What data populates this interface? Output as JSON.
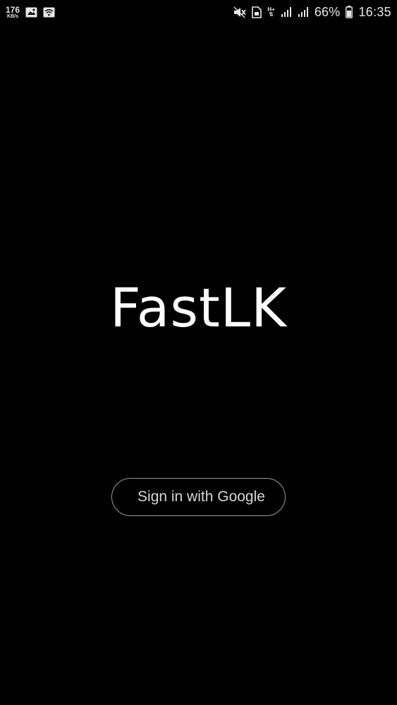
{
  "status_bar": {
    "net_speed_value": "176",
    "net_speed_unit": "KB/s",
    "signal_tech": "H+",
    "battery_percent": "66%",
    "time": "16:35",
    "left_icons": [
      "image-icon",
      "wifi-icon"
    ],
    "right_icons": [
      "mute-icon",
      "sim-icon",
      "data-arrows-icon",
      "signal-icon",
      "signal-icon",
      "battery-icon"
    ]
  },
  "main": {
    "app_title": "FastLK",
    "sign_in_label": "Sign in with Google"
  }
}
